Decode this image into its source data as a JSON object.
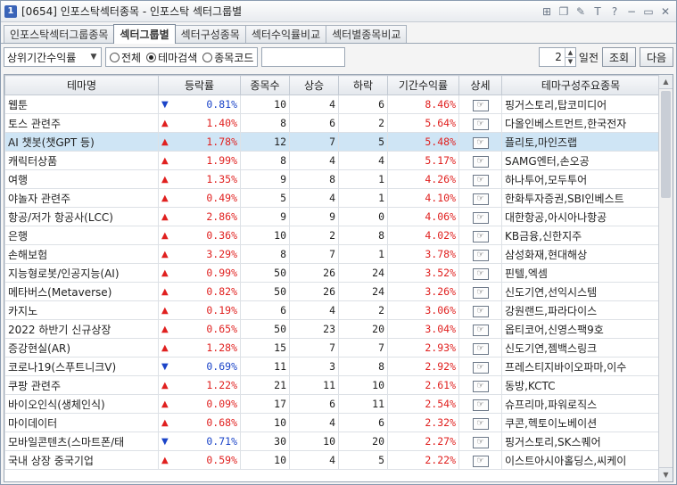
{
  "window": {
    "badge": "1",
    "title": "[0654] 인포스탁섹터종목 - 인포스탁 섹터그룹별",
    "icons": [
      "grid-icon",
      "copy-icon",
      "pin-icon",
      "font-icon",
      "help-icon",
      "minimize-icon",
      "restore-icon",
      "close-icon"
    ],
    "icon_glyphs": [
      "⊞",
      "❐",
      "✎",
      "T",
      "?",
      "−",
      "▭",
      "✕"
    ]
  },
  "tabs": [
    {
      "label": "인포스탁섹터그룹종목",
      "active": false
    },
    {
      "label": "섹터그룹별",
      "active": true
    },
    {
      "label": "섹터구성종목",
      "active": false
    },
    {
      "label": "섹터수익률비교",
      "active": false
    },
    {
      "label": "섹터별종목비교",
      "active": false
    }
  ],
  "toolbar": {
    "sort_select": "상위기간수익률",
    "radios": [
      {
        "label": "전체",
        "checked": false
      },
      {
        "label": "테마검색",
        "checked": true
      },
      {
        "label": "종목코드",
        "checked": false
      }
    ],
    "code_value": "",
    "days_value": "2",
    "days_label": "일전",
    "query_button": "조회",
    "next_button": "다음"
  },
  "table": {
    "headers": [
      "테마명",
      "등락률",
      "종목수",
      "상승",
      "하락",
      "기간수익률",
      "상세",
      "테마구성주요종목"
    ],
    "rows": [
      {
        "name": "웹툰",
        "dir": "down",
        "rate": "0.81%",
        "count": "10",
        "up": "4",
        "down": "6",
        "period": "8.46%",
        "stocks": "핑거스토리,탑코미디어"
      },
      {
        "name": "토스 관련주",
        "dir": "up",
        "rate": "1.40%",
        "count": "8",
        "up": "6",
        "down": "2",
        "period": "5.64%",
        "stocks": "다올인베스트먼트,한국전자"
      },
      {
        "name": "AI 챗봇(챗GPT 등)",
        "dir": "up",
        "rate": "1.78%",
        "count": "12",
        "up": "7",
        "down": "5",
        "period": "5.48%",
        "stocks": "플리토,마인즈랩",
        "selected": true
      },
      {
        "name": "캐릭터상품",
        "dir": "up",
        "rate": "1.99%",
        "count": "8",
        "up": "4",
        "down": "4",
        "period": "5.17%",
        "stocks": "SAMG엔터,손오공"
      },
      {
        "name": "여행",
        "dir": "up",
        "rate": "1.35%",
        "count": "9",
        "up": "8",
        "down": "1",
        "period": "4.26%",
        "stocks": "하나투어,모두투어"
      },
      {
        "name": "야놀자 관련주",
        "dir": "up",
        "rate": "0.49%",
        "count": "5",
        "up": "4",
        "down": "1",
        "period": "4.10%",
        "stocks": "한화투자증권,SBI인베스트"
      },
      {
        "name": "항공/저가 항공사(LCC)",
        "dir": "up",
        "rate": "2.86%",
        "count": "9",
        "up": "9",
        "down": "0",
        "period": "4.06%",
        "stocks": "대한항공,아시아나항공"
      },
      {
        "name": "은행",
        "dir": "up",
        "rate": "0.36%",
        "count": "10",
        "up": "2",
        "down": "8",
        "period": "4.02%",
        "stocks": "KB금융,신한지주"
      },
      {
        "name": "손해보험",
        "dir": "up",
        "rate": "3.29%",
        "count": "8",
        "up": "7",
        "down": "1",
        "period": "3.78%",
        "stocks": "삼성화재,현대해상"
      },
      {
        "name": "지능형로봇/인공지능(AI)",
        "dir": "up",
        "rate": "0.99%",
        "count": "50",
        "up": "26",
        "down": "24",
        "period": "3.52%",
        "stocks": "핀텔,엑셈"
      },
      {
        "name": "메타버스(Metaverse)",
        "dir": "up",
        "rate": "0.82%",
        "count": "50",
        "up": "26",
        "down": "24",
        "period": "3.26%",
        "stocks": "신도기연,선익시스템"
      },
      {
        "name": "카지노",
        "dir": "up",
        "rate": "0.19%",
        "count": "6",
        "up": "4",
        "down": "2",
        "period": "3.06%",
        "stocks": "강원랜드,파라다이스"
      },
      {
        "name": "2022 하반기 신규상장",
        "dir": "up",
        "rate": "0.65%",
        "count": "50",
        "up": "23",
        "down": "20",
        "period": "3.04%",
        "stocks": "옵티코어,신영스팩9호"
      },
      {
        "name": "증강현실(AR)",
        "dir": "up",
        "rate": "1.28%",
        "count": "15",
        "up": "7",
        "down": "7",
        "period": "2.93%",
        "stocks": "신도기연,젬백스링크"
      },
      {
        "name": "코로나19(스푸트니크V)",
        "dir": "down",
        "rate": "0.69%",
        "count": "11",
        "up": "3",
        "down": "8",
        "period": "2.92%",
        "stocks": "프레스티지바이오파마,이수"
      },
      {
        "name": "쿠팡 관련주",
        "dir": "up",
        "rate": "1.22%",
        "count": "21",
        "up": "11",
        "down": "10",
        "period": "2.61%",
        "stocks": "동방,KCTC"
      },
      {
        "name": "바이오인식(생체인식)",
        "dir": "up",
        "rate": "0.09%",
        "count": "17",
        "up": "6",
        "down": "11",
        "period": "2.54%",
        "stocks": "슈프리마,파워로직스"
      },
      {
        "name": "마이데이터",
        "dir": "up",
        "rate": "0.68%",
        "count": "10",
        "up": "4",
        "down": "6",
        "period": "2.32%",
        "stocks": "쿠콘,헥토이노베이션"
      },
      {
        "name": "모바일콘텐츠(스마트폰/태",
        "dir": "down",
        "rate": "0.71%",
        "count": "30",
        "up": "10",
        "down": "20",
        "period": "2.27%",
        "stocks": "핑거스토리,SK스퀘어"
      },
      {
        "name": "국내 상장 중국기업",
        "dir": "up",
        "rate": "0.59%",
        "count": "10",
        "up": "4",
        "down": "5",
        "period": "2.22%",
        "stocks": "이스트아시아홀딩스,씨케이"
      }
    ]
  }
}
